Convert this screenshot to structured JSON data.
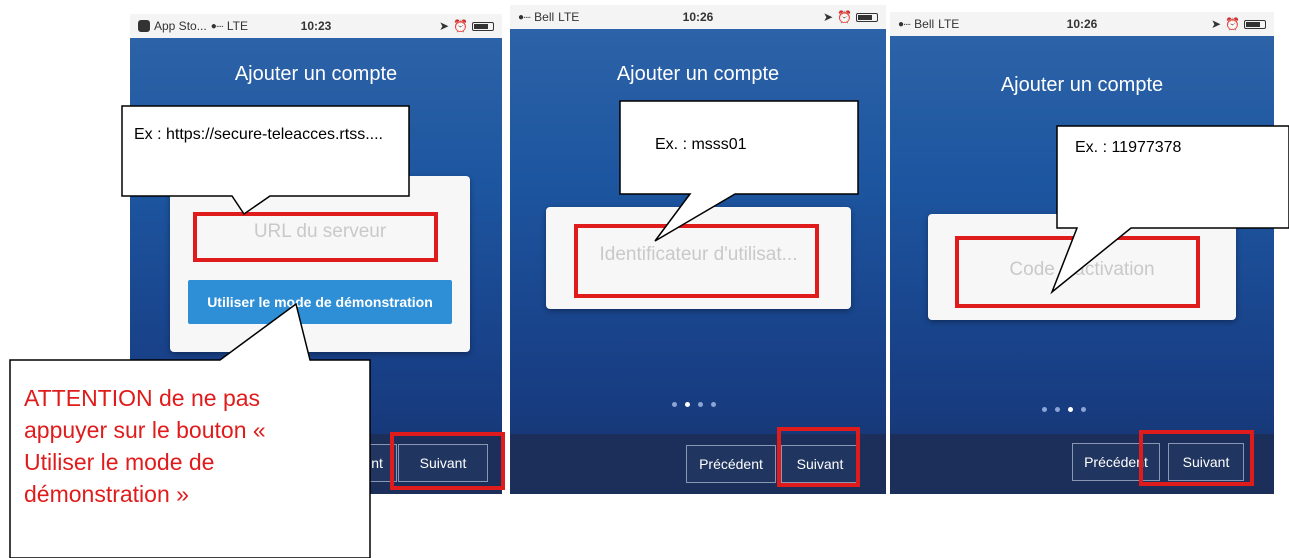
{
  "screens": [
    {
      "status": {
        "carrier": "App Sto...",
        "network": "LTE",
        "time": "10:23"
      },
      "title": "Ajouter un compte",
      "field_placeholder": "URL du serveur",
      "demo_button": "Utiliser le mode de démonstration",
      "prev_button": "Précédent",
      "next_button": "Suivant"
    },
    {
      "status": {
        "carrier": "Bell",
        "network": "LTE",
        "time": "10:26"
      },
      "title": "Ajouter un compte",
      "field_placeholder": "Identificateur d'utilisat...",
      "prev_button": "Précédent",
      "next_button": "Suivant",
      "page_indicator": {
        "current": 2,
        "total": 4
      }
    },
    {
      "status": {
        "carrier": "Bell",
        "network": "LTE",
        "time": "10:26"
      },
      "title": "Ajouter un compte",
      "field_placeholder": "Code d'activation",
      "prev_button": "Précédent",
      "next_button": "Suivant",
      "page_indicator": {
        "current": 3,
        "total": 4
      }
    }
  ],
  "callouts": {
    "url_example": "Ex : https://secure-teleacces.rtss....",
    "user_example": "Ex. : msss01",
    "code_example": "Ex. : 11977378",
    "warning": "ATTENTION de ne pas appuyer sur le bouton « Utiliser le mode de démonstration »"
  },
  "colors": {
    "highlight": "#e01b1b",
    "warning_text": "#e01b1b",
    "app_blue": "#1d56a0"
  }
}
